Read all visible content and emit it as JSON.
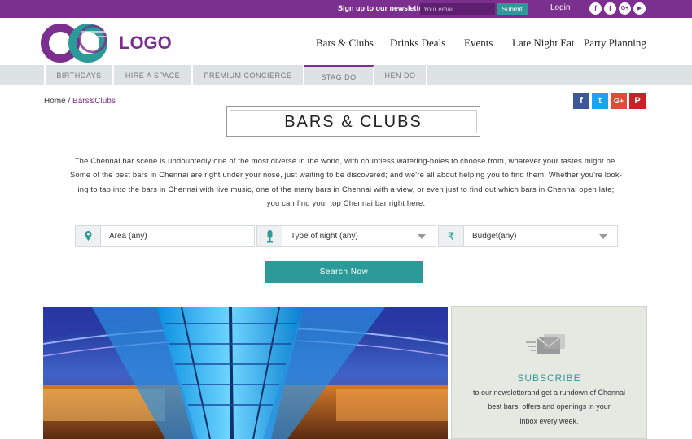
{
  "topbar": {
    "newsletter_label": "Sign up to our newsletter",
    "email_placeholder": "Your email",
    "submit_label": "Submit",
    "login_label": "Login",
    "social": [
      "f",
      "t",
      "G+",
      "▶"
    ]
  },
  "header": {
    "logo_text": "LOGO",
    "nav": [
      "Bars & Clubs",
      "Drinks Deals",
      "Events",
      "Late Night Eat",
      "Party Planning"
    ]
  },
  "subnav": {
    "items": [
      "BIRTHDAYS",
      "HIRE A SPACE",
      "PREMIUM CONCIERGE",
      "STAG DO",
      "HEN DO"
    ],
    "active": "STAG DO"
  },
  "breadcrumb": {
    "home": "Home",
    "separator": "/",
    "current": "Bars&Clubs"
  },
  "share": {
    "facebook": "f",
    "twitter": "t",
    "google": "G+",
    "pinterest": "P"
  },
  "page_title": "BARS & CLUBS",
  "intro": [
    "The Chennai bar scene is undoubtedly one of the most diverse in the world, with countless watering-holes to choose from, whatever your tastes might be.",
    "Some of the best bars in Chennai are right under your nose, just waiting to be discovered; and we're all about helping you to find them. Whether you're look-",
    "ing to tap into the bars in Chennai with live music, one of the many bars in Chennai with a view, or even just to find out which bars in Chennai open late;",
    "you can find your top Chennai bar right here."
  ],
  "filters": {
    "area": "Area (any)",
    "night": "Type of night (any)",
    "budget": "Budget(any)",
    "budget_icon": "₹"
  },
  "search_label": "Search Now",
  "subscribe": {
    "title": "SUBSCRIBE",
    "desc": [
      "to our newsletterand get a rundown of Chennai",
      "best bars, offers and openings in your",
      "inbox every week."
    ]
  },
  "colors": {
    "brand": "#7b2f8e",
    "accent": "#2b9a98",
    "facebook": "#3b5998",
    "twitter": "#1da1f2",
    "google": "#dd4b39",
    "pinterest": "#cb2027"
  }
}
